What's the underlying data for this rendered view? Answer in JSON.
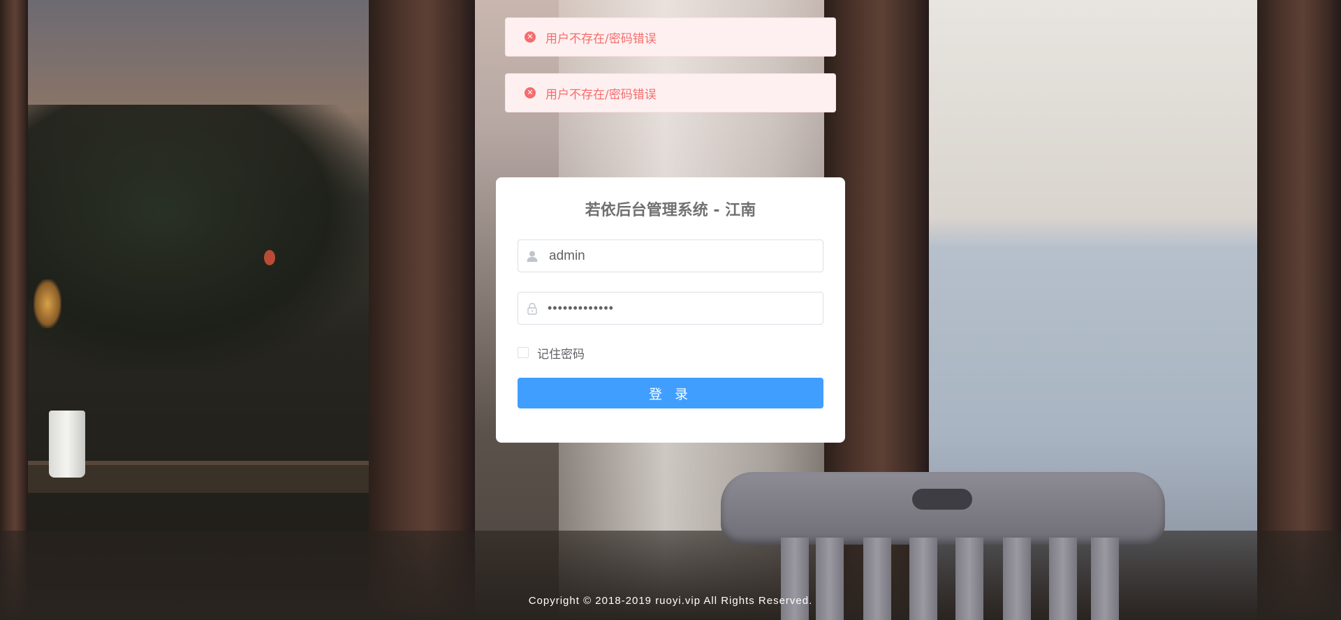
{
  "messages": [
    {
      "icon": "error-circle-icon",
      "text": "用户不存在/密码错误"
    },
    {
      "icon": "error-circle-icon",
      "text": "用户不存在/密码错误"
    }
  ],
  "login": {
    "title": "若依后台管理系统 - 江南",
    "username": {
      "icon": "user-icon",
      "value": "admin"
    },
    "password": {
      "icon": "lock-icon",
      "value": "•••••••••••••"
    },
    "remember_label": "记住密码",
    "remember_checked": false,
    "submit_label": "登 录"
  },
  "footer": {
    "copyright": "Copyright © 2018-2019 ruoyi.vip All Rights Reserved."
  },
  "colors": {
    "error_text": "#f56c6c",
    "error_bg": "#fef0f0",
    "primary": "#409eff",
    "title": "#707070"
  }
}
